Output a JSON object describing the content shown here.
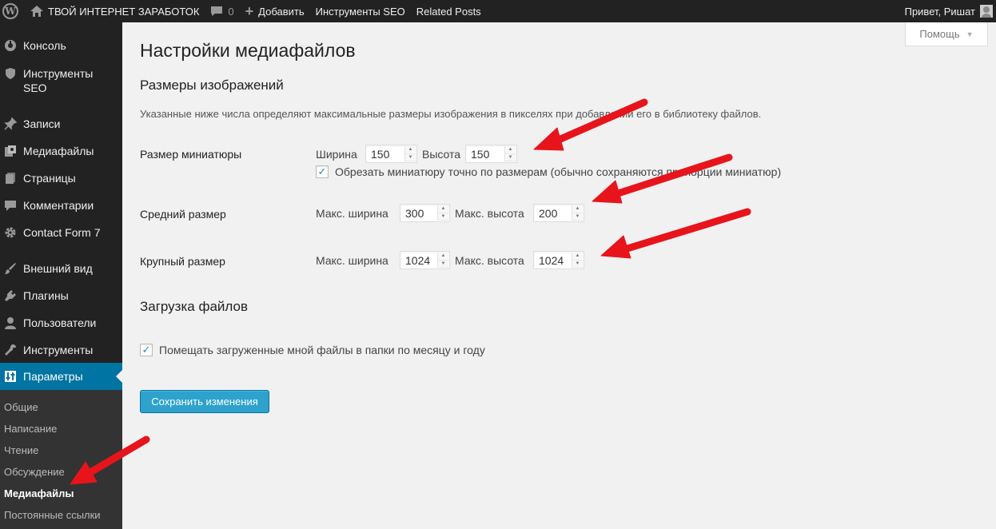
{
  "adminbar": {
    "site_name": "ТВОЙ ИНТЕРНЕТ ЗАРАБОТОК",
    "comments_count": "0",
    "add_new": "Добавить",
    "seo_tools": "Инструменты SEO",
    "related_posts": "Related Posts",
    "greeting": "Привет, Ришат"
  },
  "help_tab": {
    "label": "Помощь"
  },
  "sidebar": {
    "items": [
      {
        "label": "Консоль",
        "icon": "dashboard-icon"
      },
      {
        "label": "Инструменты SEO",
        "icon": "shield-icon"
      },
      {
        "label": "Записи",
        "icon": "pin-icon"
      },
      {
        "label": "Медиафайлы",
        "icon": "media-icon"
      },
      {
        "label": "Страницы",
        "icon": "pages-icon"
      },
      {
        "label": "Комментарии",
        "icon": "comment-icon"
      },
      {
        "label": "Contact Form 7",
        "icon": "gear-icon"
      },
      {
        "label": "Внешний вид",
        "icon": "brush-icon"
      },
      {
        "label": "Плагины",
        "icon": "plugin-icon"
      },
      {
        "label": "Пользователи",
        "icon": "user-icon"
      },
      {
        "label": "Инструменты",
        "icon": "wrench-icon"
      },
      {
        "label": "Параметры",
        "icon": "settings-icon"
      }
    ],
    "submenu": [
      "Общие",
      "Написание",
      "Чтение",
      "Обсуждение",
      "Медиафайлы",
      "Постоянные ссылки"
    ],
    "active_submenu": "Медиафайлы",
    "accent_color": "#0074a2"
  },
  "main": {
    "title": "Настройки медиафайлов",
    "image_sizes": {
      "heading": "Размеры изображений",
      "description": "Указанные ниже числа определяют максимальные размеры изображения в пикселях при добавлении его в библиотеку файлов.",
      "thumbnail": {
        "label": "Размер миниатюры",
        "width_label": "Ширина",
        "width": "150",
        "height_label": "Высота",
        "height": "150",
        "crop_label": "Обрезать миниатюру точно по размерам (обычно сохраняются пропорции миниатюр)",
        "crop_checked": true
      },
      "medium": {
        "label": "Средний размер",
        "width_label": "Макс. ширина",
        "width": "300",
        "height_label": "Макс. высота",
        "height": "200"
      },
      "large": {
        "label": "Крупный размер",
        "width_label": "Макс. ширина",
        "width": "1024",
        "height_label": "Макс. высота",
        "height": "1024"
      }
    },
    "uploads": {
      "heading": "Загрузка файлов",
      "organize_label": "Помещать загруженные мной файлы в папки по месяцу и году",
      "organize_checked": true
    },
    "save_label": "Сохранить изменения",
    "button_color": "#2ea2cc"
  },
  "annotation_color": "#e8141b"
}
